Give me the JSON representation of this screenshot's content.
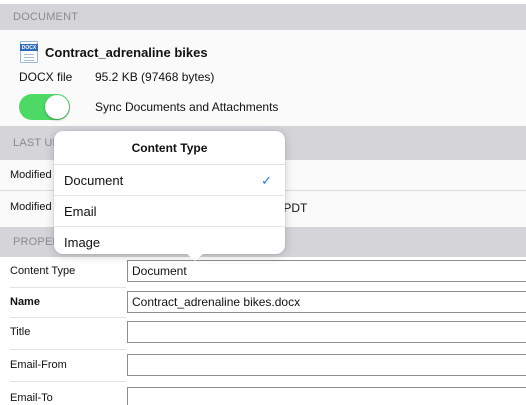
{
  "document_section": {
    "header": "DOCUMENT",
    "icon": "docx-file-icon",
    "title": "Contract_adrenaline bikes",
    "file_type": "DOCX file",
    "file_size": "95.2 KB (97468 bytes)",
    "sync_toggle": {
      "on": true,
      "label": "Sync Documents and Attachments"
    }
  },
  "last_updated_section": {
    "header": "LAST UPDATED",
    "rows": [
      {
        "label": "Modified",
        "value": ""
      },
      {
        "label": "Modified",
        "value": "M PDT"
      }
    ]
  },
  "properties_section": {
    "header": "PROPERTIES",
    "fields": [
      {
        "label": "Content Type",
        "value": "Document"
      },
      {
        "label": "Name",
        "value": "Contract_adrenaline bikes.docx"
      },
      {
        "label": "Title",
        "value": ""
      },
      {
        "label": "Email-From",
        "value": ""
      },
      {
        "label": "Email-To",
        "value": ""
      }
    ]
  },
  "content_type_popover": {
    "title": "Content Type",
    "options": [
      {
        "label": "Document",
        "selected": true
      },
      {
        "label": "Email",
        "selected": false
      },
      {
        "label": "Image",
        "selected": false
      }
    ],
    "check_glyph": "✓"
  },
  "colors": {
    "toggle_on": "#4cd964",
    "check": "#1f7ae0",
    "section_header_bg": "#d4d4d9"
  }
}
